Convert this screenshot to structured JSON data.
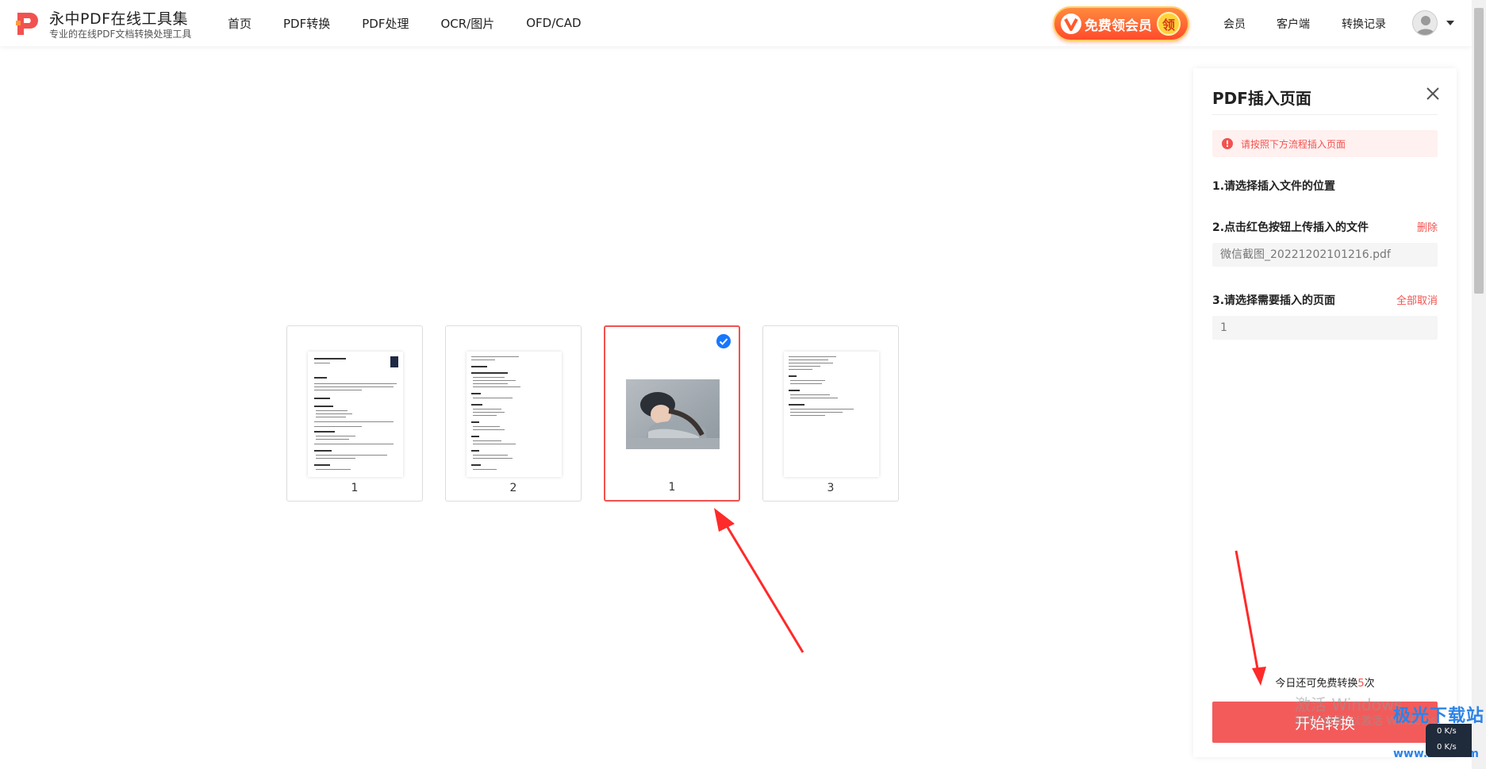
{
  "header": {
    "brand_title": "永中PDF在线工具集",
    "brand_subtitle": "专业的在线PDF文档转换处理工具",
    "nav": [
      "首页",
      "PDF转换",
      "PDF处理",
      "OCR/图片",
      "OFD/CAD"
    ],
    "vip_badge": "免费领会员",
    "vip_badge_tag": "领",
    "right_links": [
      "会员",
      "客户端",
      "转换记录"
    ],
    "avatar_icon": "user-avatar-icon"
  },
  "pages": [
    {
      "label": "1",
      "kind": "document",
      "selected": false
    },
    {
      "label": "2",
      "kind": "document",
      "selected": false
    },
    {
      "label": "1",
      "kind": "image",
      "selected": true
    },
    {
      "label": "3",
      "kind": "document",
      "selected": false
    }
  ],
  "panel": {
    "title": "PDF插入页面",
    "notice": "请按照下方流程插入页面",
    "notice_icon": "!",
    "step1": "1.请选择插入文件的位置",
    "step2": "2.点击红色按钮上传插入的文件",
    "step2_action": "删除",
    "file_name": "微信截图_20221202101216.pdf",
    "step3": "3.请选择需要插入的页面",
    "step3_action": "全部取消",
    "pages_value": "1",
    "free_prefix": "今日还可免费转换",
    "free_count": "5",
    "free_suffix": "次",
    "start_button": "开始转换"
  },
  "overlay": {
    "activation_title": "激活 Windows",
    "activation_sub": "转到\"设置\"以激活 Windows。",
    "net_up": "0 K/s",
    "net_down": "0 K/s",
    "site_watermark": "极光下载站",
    "site_url": "www.xz7.com"
  },
  "colors": {
    "accent_red": "#f35b5b",
    "check_blue": "#1677ff",
    "arrow_red": "#ff2a2a"
  }
}
